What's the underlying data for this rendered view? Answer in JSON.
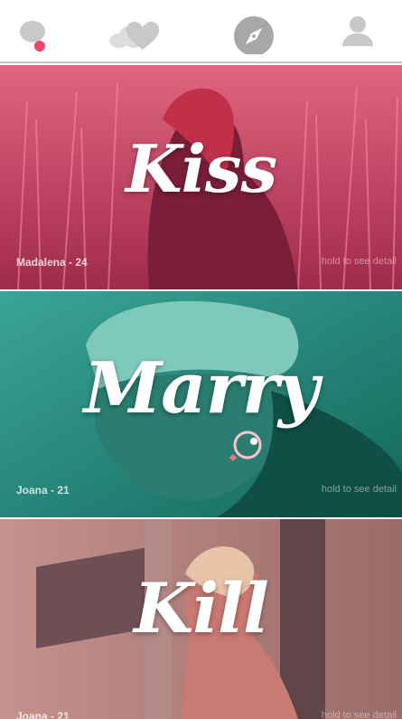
{
  "colors": {
    "kiss_tint": "#d03760",
    "marry_tint": "#1a8a78",
    "kill_tint": "#b07c78",
    "badge": "#f0436e",
    "icon_gray": "#c8c8c8",
    "compass_gray": "#a8a8a8"
  },
  "nav": {
    "items": [
      {
        "name": "chat",
        "icon": "chat-bubble-icon",
        "has_notification": true
      },
      {
        "name": "likes",
        "icon": "cloud-heart-icon",
        "has_notification": false
      },
      {
        "name": "discover",
        "icon": "compass-icon",
        "has_notification": false,
        "active": true
      },
      {
        "name": "profile",
        "icon": "person-icon",
        "has_notification": false
      }
    ]
  },
  "cards": [
    {
      "word": "Kiss",
      "person": "Madalena - 24",
      "hint": "hold to see detail"
    },
    {
      "word": "Marry",
      "person": "Joana - 21",
      "hint": "hold to see detail",
      "overlay_icon": "ring-icon"
    },
    {
      "word": "Kill",
      "person": "Joana - 21",
      "hint": "hold to see detail",
      "overlay_icon": "knife-icon"
    }
  ]
}
